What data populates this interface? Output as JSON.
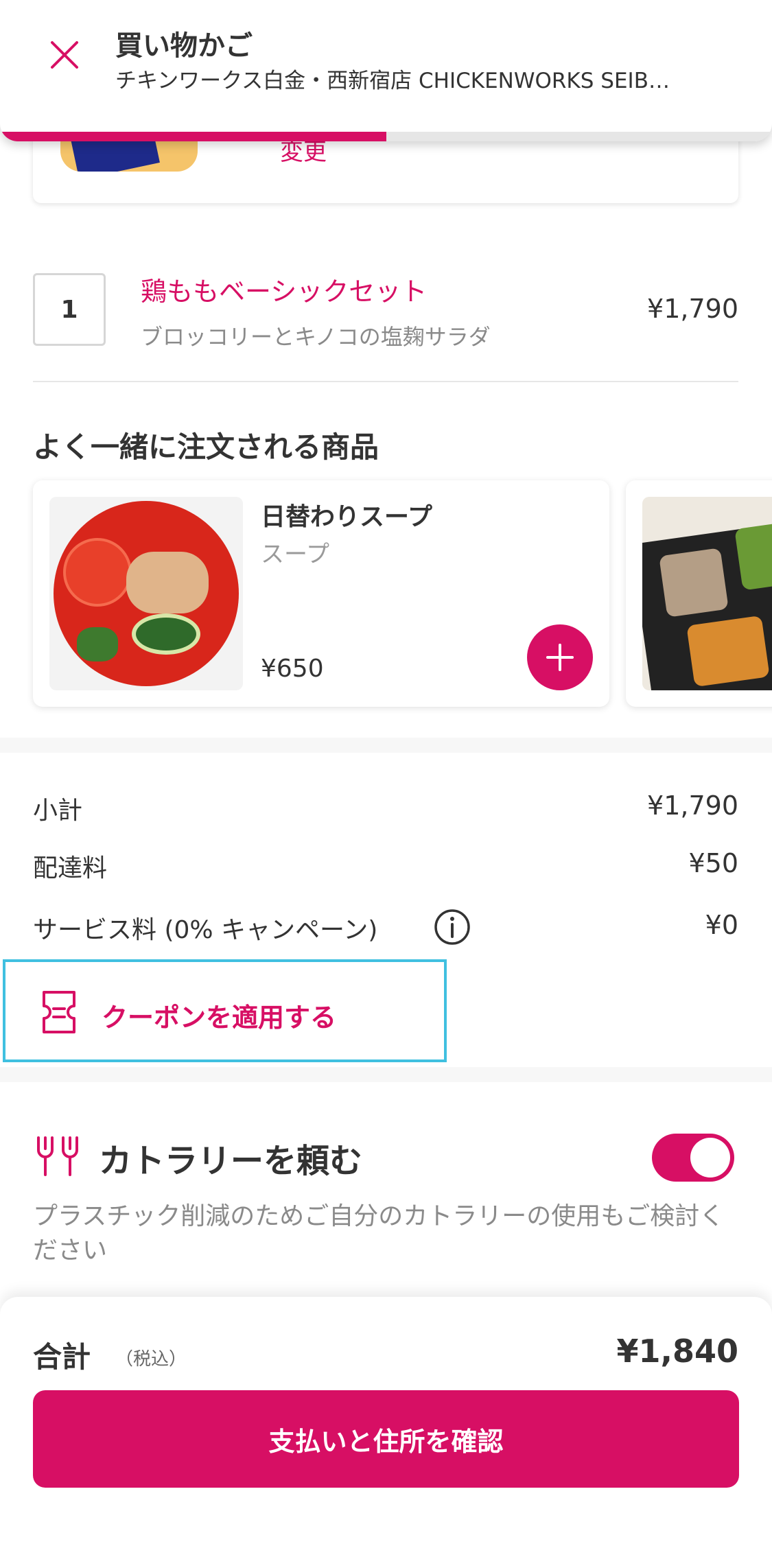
{
  "header": {
    "title": "買い物かご",
    "restaurant": "チキンワークス白金・西新宿店 CHICKENWORKS SEIB…",
    "progress": 0.5
  },
  "address_card": {
    "change_label": "変更"
  },
  "cart": {
    "items": [
      {
        "quantity": "1",
        "name": "鶏ももベーシックセット",
        "option": "ブロッコリーとキノコの塩麹サラダ",
        "price": "¥1,790"
      }
    ]
  },
  "recommendations": {
    "title": "よく一緒に注文される商品",
    "items": [
      {
        "name": "日替わりスープ",
        "category": "スープ",
        "price": "¥650"
      }
    ]
  },
  "summary": {
    "subtotal_label": "小計",
    "subtotal_value": "¥1,790",
    "delivery_label": "配達料",
    "delivery_value": "¥50",
    "service_label": "サービス料 (0% キャンペーン)",
    "service_value": "¥0"
  },
  "coupon": {
    "label": "クーポンを適用する"
  },
  "cutlery": {
    "title": "カトラリーを頼む",
    "enabled": true,
    "note": "プラスチック削減のためご自分のカトラリーの使用もご検討ください"
  },
  "total": {
    "label": "合計",
    "note": "（税込）",
    "value": "¥1,840"
  },
  "checkout": {
    "button_label": "支払いと住所を確認"
  },
  "colors": {
    "accent": "#d70f64",
    "highlight": "#40c0e0"
  },
  "icons": [
    "close-icon",
    "info-icon",
    "coupon-icon",
    "cutlery-icon",
    "plus-icon"
  ]
}
